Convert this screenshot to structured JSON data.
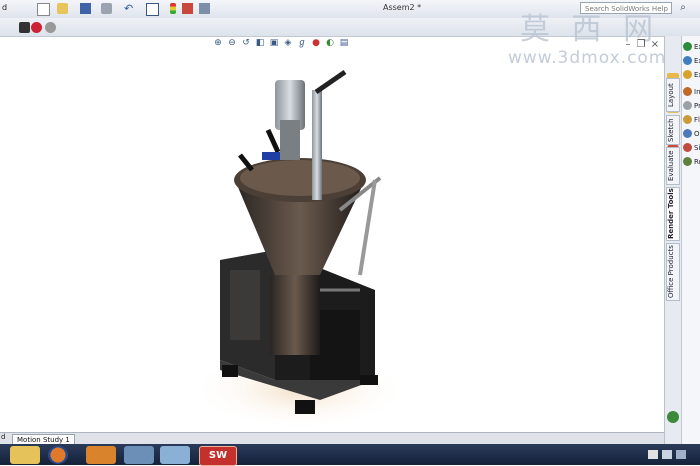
{
  "app": {
    "document_title": "Assem2 *",
    "search_placeholder": "Search SolidWorks Help"
  },
  "watermark": {
    "text": "莫 西 网",
    "url": "www.3dmox.com"
  },
  "left_edge_label": "d",
  "taskpane": {
    "tabs": [
      {
        "label": "Layout"
      },
      {
        "label": "Sketch"
      },
      {
        "label": "Evaluate"
      },
      {
        "label": "Render Tools"
      },
      {
        "label": "Office Products"
      }
    ],
    "list_items": [
      {
        "label": "Ex",
        "color": "#2e8b3d"
      },
      {
        "label": "Ex",
        "color": "#3f7fbf"
      },
      {
        "label": "Ex",
        "color": "#d9a22b"
      },
      {
        "label": "In",
        "color": "#c06a28"
      },
      {
        "label": "Pr",
        "color": "#9aa0a8"
      },
      {
        "label": "Fl",
        "color": "#c99a3a"
      },
      {
        "label": "O",
        "color": "#4b79b8"
      },
      {
        "label": "Si",
        "color": "#c04b40"
      },
      {
        "label": "Ro",
        "color": "#5f7f3f"
      }
    ]
  },
  "bottom": {
    "motion_tab": "Motion Study 1"
  },
  "taskbar": {
    "items": [
      {
        "name": "file-explorer",
        "color": "#e6c35a"
      },
      {
        "name": "firefox",
        "color": "#e07a2a"
      },
      {
        "name": "media-player",
        "color": "#d9832c"
      },
      {
        "name": "window-app",
        "color": "#6c8fb8"
      },
      {
        "name": "paint",
        "color": "#8ab0d6"
      },
      {
        "name": "solidworks",
        "color": "#c4302b"
      }
    ],
    "solidworks_label": "SW"
  }
}
